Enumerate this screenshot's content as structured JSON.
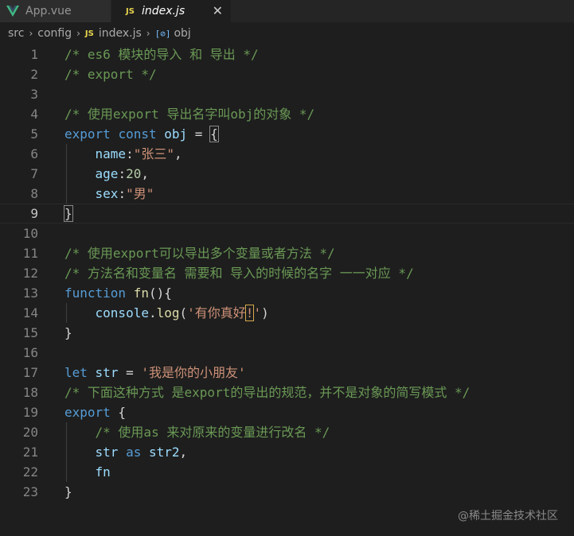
{
  "tabs": [
    {
      "label": "App.vue",
      "icon": "vue-icon",
      "active": false
    },
    {
      "label": "index.js",
      "icon": "js-icon",
      "active": true
    }
  ],
  "tab_close_glyph": "✕",
  "js_icon_text": "JS",
  "breadcrumb": {
    "items": [
      "src",
      "config",
      "index.js",
      "obj"
    ],
    "obj_icon_text": "[⊘]",
    "separator": "›"
  },
  "editor": {
    "lines": [
      {
        "n": "1",
        "tokens": [
          {
            "t": "/* es6 模块的导入 和 导出 */",
            "c": "comment"
          }
        ]
      },
      {
        "n": "2",
        "tokens": [
          {
            "t": "/* export */",
            "c": "comment"
          }
        ]
      },
      {
        "n": "3",
        "tokens": []
      },
      {
        "n": "4",
        "tokens": [
          {
            "t": "/* 使用export 导出名字叫obj的对象 */",
            "c": "comment"
          }
        ]
      },
      {
        "n": "5",
        "tokens": [
          {
            "t": "export",
            "c": "kw"
          },
          {
            "t": " ",
            "c": "plain"
          },
          {
            "t": "const",
            "c": "kw"
          },
          {
            "t": " ",
            "c": "plain"
          },
          {
            "t": "obj",
            "c": "var"
          },
          {
            "t": " = ",
            "c": "plain"
          },
          {
            "t": "{",
            "c": "plain",
            "box": "bracket"
          }
        ]
      },
      {
        "n": "6",
        "tokens": [
          {
            "t": "    ",
            "c": "plain"
          },
          {
            "t": "name",
            "c": "prop"
          },
          {
            "t": ":",
            "c": "plain"
          },
          {
            "t": "\"张三\"",
            "c": "str"
          },
          {
            "t": ",",
            "c": "plain"
          }
        ]
      },
      {
        "n": "7",
        "tokens": [
          {
            "t": "    ",
            "c": "plain"
          },
          {
            "t": "age",
            "c": "prop"
          },
          {
            "t": ":",
            "c": "plain"
          },
          {
            "t": "20",
            "c": "num"
          },
          {
            "t": ",",
            "c": "plain"
          }
        ]
      },
      {
        "n": "8",
        "tokens": [
          {
            "t": "    ",
            "c": "plain"
          },
          {
            "t": "sex",
            "c": "prop"
          },
          {
            "t": ":",
            "c": "plain"
          },
          {
            "t": "\"男\"",
            "c": "str"
          }
        ]
      },
      {
        "n": "9",
        "current": true,
        "tokens": [
          {
            "t": "}",
            "c": "plain",
            "box": "bracket"
          }
        ]
      },
      {
        "n": "10",
        "tokens": []
      },
      {
        "n": "11",
        "tokens": [
          {
            "t": "/* 使用export可以导出多个变量或者方法 */",
            "c": "comment"
          }
        ]
      },
      {
        "n": "12",
        "tokens": [
          {
            "t": "/* 方法名和变量名 需要和 导入的时候的名字 一一对应 */",
            "c": "comment"
          }
        ]
      },
      {
        "n": "13",
        "tokens": [
          {
            "t": "function",
            "c": "kw"
          },
          {
            "t": " ",
            "c": "plain"
          },
          {
            "t": "fn",
            "c": "fn"
          },
          {
            "t": "(){",
            "c": "plain"
          }
        ]
      },
      {
        "n": "14",
        "tokens": [
          {
            "t": "    ",
            "c": "plain"
          },
          {
            "t": "console",
            "c": "var"
          },
          {
            "t": ".",
            "c": "plain"
          },
          {
            "t": "log",
            "c": "fn"
          },
          {
            "t": "(",
            "c": "plain"
          },
          {
            "t": "'有你真好",
            "c": "str"
          },
          {
            "t": "!",
            "c": "str",
            "box": "highlight"
          },
          {
            "t": "'",
            "c": "str"
          },
          {
            "t": ")",
            "c": "plain"
          }
        ]
      },
      {
        "n": "15",
        "tokens": [
          {
            "t": "}",
            "c": "plain"
          }
        ]
      },
      {
        "n": "16",
        "tokens": []
      },
      {
        "n": "17",
        "tokens": [
          {
            "t": "let",
            "c": "kw"
          },
          {
            "t": " ",
            "c": "plain"
          },
          {
            "t": "str",
            "c": "var"
          },
          {
            "t": " = ",
            "c": "plain"
          },
          {
            "t": "'我是你的小朋友'",
            "c": "str"
          }
        ]
      },
      {
        "n": "18",
        "tokens": [
          {
            "t": "/* 下面这种方式 是export的导出的规范，并不是对象的简写模式 */",
            "c": "comment"
          }
        ]
      },
      {
        "n": "19",
        "tokens": [
          {
            "t": "export",
            "c": "kw"
          },
          {
            "t": " {",
            "c": "plain"
          }
        ]
      },
      {
        "n": "20",
        "tokens": [
          {
            "t": "    ",
            "c": "plain"
          },
          {
            "t": "/* 使用as 来对原来的变量进行改名 */",
            "c": "comment"
          }
        ]
      },
      {
        "n": "21",
        "tokens": [
          {
            "t": "    ",
            "c": "plain"
          },
          {
            "t": "str",
            "c": "var"
          },
          {
            "t": " ",
            "c": "plain"
          },
          {
            "t": "as",
            "c": "kw"
          },
          {
            "t": " ",
            "c": "plain"
          },
          {
            "t": "str2",
            "c": "var"
          },
          {
            "t": ",",
            "c": "plain"
          }
        ]
      },
      {
        "n": "22",
        "tokens": [
          {
            "t": "    ",
            "c": "plain"
          },
          {
            "t": "fn",
            "c": "var"
          }
        ]
      },
      {
        "n": "23",
        "tokens": [
          {
            "t": "}",
            "c": "plain"
          }
        ]
      }
    ]
  },
  "watermark": "@稀土掘金技术社区",
  "colors": {
    "background": "#1e1e1e",
    "comment": "#6a9955",
    "keyword": "#569cd6",
    "variable": "#9cdcfe",
    "string": "#ce9178",
    "number": "#b5cea8",
    "function": "#dcdcaa",
    "plain": "#d4d4d4",
    "line_number": "#858585"
  }
}
